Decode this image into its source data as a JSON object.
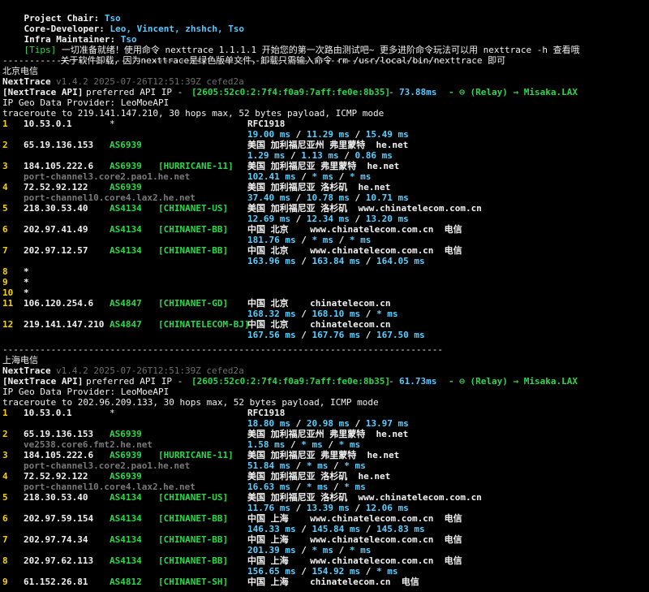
{
  "header": {
    "chair_label": "Project Chair:",
    "chair": "Tso",
    "dev_label": "Core-Developer:",
    "devs": [
      "Leo,",
      "Vincent,",
      "zhshch,",
      "Tso"
    ],
    "maint_label": "Infra Maintainer:",
    "maint": "Tso",
    "tips_tag": "[Tips]",
    "tips_1": "一切准备就绪！使用命令 nexttrace 1.1.1.1 开始您的第一次路由测试吧~ 更多进阶命令玩法可以用 nexttrace -h 查看哦",
    "tips_2": "关于软件卸载，因为nexttrace是绿色版单文件，卸载只需输入命令 rm /usr/local/bin/nexttrace 即可"
  },
  "separator": "----------------------------------------------------------------------------------",
  "sections": [
    {
      "title": "北京电信",
      "app": "NextTrace",
      "version": "v1.4.2 2025-07-26T12:51:39Z cefed2a",
      "api_label": "[NextTrace API]",
      "api_text": "preferred API IP -",
      "api_ip": "[2605:52c0:2:7f4:f0a9:7aff:fe0e:8b35]",
      "api_dash": "-",
      "api_latency": "73.88ms",
      "api_relay": "- ⊖ (Relay) → Misaka.LAX",
      "geo": "IP Geo Data Provider: LeoMoeAPI",
      "trace": "traceroute to 219.141.147.210, 30 hops max, 52 bytes payload, ICMP mode",
      "hops": [
        {
          "n": "1",
          "ip": "10.53.0.1",
          "asn": "*",
          "tag": "",
          "geo": "RFC1918",
          "ptr": "",
          "t1": "19.00 ms",
          "t2": "11.29 ms",
          "t3": "15.49 ms"
        },
        {
          "n": "2",
          "ip": "65.19.136.153",
          "asn": "AS6939",
          "tag": "",
          "geo": "美国 加利福尼亚州 弗里蒙特  he.net",
          "ptr": "",
          "t1": "1.29 ms",
          "t2": "1.13 ms",
          "t3": "0.86 ms"
        },
        {
          "n": "3",
          "ip": "184.105.222.6",
          "asn": "AS6939",
          "tag": "[HURRICANE-11]",
          "geo": "美国 加利福尼亚 弗里蒙特  he.net",
          "ptr": "port-channel3.core2.pao1.he.net",
          "t1": "102.41 ms",
          "t2": "* ms",
          "t3": "* ms"
        },
        {
          "n": "4",
          "ip": "72.52.92.122",
          "asn": "AS6939",
          "tag": "",
          "geo": "美国 加利福尼亚 洛杉矶  he.net",
          "ptr": "port-channel10.core4.lax2.he.net",
          "t1": "37.40 ms",
          "t2": "10.78 ms",
          "t3": "10.71 ms"
        },
        {
          "n": "5",
          "ip": "218.30.53.40",
          "asn": "AS4134",
          "tag": "[CHINANET-US]",
          "geo": "美国 加利福尼亚 洛杉矶  www.chinatelecom.com.cn",
          "ptr": "",
          "t1": "12.69 ms",
          "t2": "12.34 ms",
          "t3": "13.20 ms"
        },
        {
          "n": "6",
          "ip": "202.97.41.49",
          "asn": "AS4134",
          "tag": "[CHINANET-BB]",
          "geo": "中国 北京    www.chinatelecom.com.cn  电信",
          "ptr": "",
          "t1": "181.76 ms",
          "t2": "* ms",
          "t3": "* ms"
        },
        {
          "n": "7",
          "ip": "202.97.12.57",
          "asn": "AS4134",
          "tag": "[CHINANET-BB]",
          "geo": "中国 北京    www.chinatelecom.com.cn  电信",
          "ptr": "",
          "t1": "163.96 ms",
          "t2": "163.84 ms",
          "t3": "164.05 ms"
        },
        {
          "n": "8",
          "ip": "*",
          "asn": "",
          "tag": "",
          "geo": "",
          "ptr": "",
          "t1": "",
          "t2": "",
          "t3": ""
        },
        {
          "n": "9",
          "ip": "*",
          "asn": "",
          "tag": "",
          "geo": "",
          "ptr": "",
          "t1": "",
          "t2": "",
          "t3": ""
        },
        {
          "n": "10",
          "ip": "*",
          "asn": "",
          "tag": "",
          "geo": "",
          "ptr": "",
          "t1": "",
          "t2": "",
          "t3": ""
        },
        {
          "n": "11",
          "ip": "106.120.254.6",
          "asn": "AS4847",
          "tag": "[CHINANET-GD]",
          "geo": "中国 北京    chinatelecom.cn",
          "ptr": "",
          "t1": "168.32 ms",
          "t2": "168.10 ms",
          "t3": "* ms"
        },
        {
          "n": "12",
          "ip": "219.141.147.210",
          "asn": "AS4847",
          "tag": "[CHINATELECOM-BJ]",
          "geo": "中国 北京    chinatelecom.cn",
          "ptr": "",
          "t1": "167.56 ms",
          "t2": "167.76 ms",
          "t3": "167.50 ms"
        }
      ]
    },
    {
      "title": "上海电信",
      "app": "NextTrace",
      "version": "v1.4.2 2025-07-26T12:51:39Z cefed2a",
      "api_label": "[NextTrace API]",
      "api_text": "preferred API IP -",
      "api_ip": "[2605:52c0:2:7f4:f0a9:7aff:fe0e:8b35]",
      "api_dash": "-",
      "api_latency": "61.73ms",
      "api_relay": "- ⊖ (Relay) → Misaka.LAX",
      "geo": "IP Geo Data Provider: LeoMoeAPI",
      "trace": "traceroute to 202.96.209.133, 30 hops max, 52 bytes payload, ICMP mode",
      "hops": [
        {
          "n": "1",
          "ip": "10.53.0.1",
          "asn": "*",
          "tag": "",
          "geo": "RFC1918",
          "ptr": "",
          "t1": "18.80 ms",
          "t2": "20.98 ms",
          "t3": "13.97 ms"
        },
        {
          "n": "2",
          "ip": "65.19.136.153",
          "asn": "AS6939",
          "tag": "",
          "geo": "美国 加利福尼亚州 弗里蒙特  he.net",
          "ptr": "ve2538.core6.fmt2.he.net",
          "t1": "1.58 ms",
          "t2": "* ms",
          "t3": "* ms"
        },
        {
          "n": "3",
          "ip": "184.105.222.6",
          "asn": "AS6939",
          "tag": "[HURRICANE-11]",
          "geo": "美国 加利福尼亚 弗里蒙特  he.net",
          "ptr": "port-channel3.core2.pao1.he.net",
          "t1": "51.84 ms",
          "t2": "* ms",
          "t3": "* ms"
        },
        {
          "n": "4",
          "ip": "72.52.92.122",
          "asn": "AS6939",
          "tag": "",
          "geo": "美国 加利福尼亚 洛杉矶  he.net",
          "ptr": "port-channel10.core4.lax2.he.net",
          "t1": "16.63 ms",
          "t2": "* ms",
          "t3": "* ms"
        },
        {
          "n": "5",
          "ip": "218.30.53.40",
          "asn": "AS4134",
          "tag": "[CHINANET-US]",
          "geo": "美国 加利福尼亚 洛杉矶  www.chinatelecom.com.cn",
          "ptr": "",
          "t1": "11.76 ms",
          "t2": "13.39 ms",
          "t3": "12.06 ms"
        },
        {
          "n": "6",
          "ip": "202.97.59.154",
          "asn": "AS4134",
          "tag": "[CHINANET-BB]",
          "geo": "中国 上海    www.chinatelecom.com.cn  电信",
          "ptr": "",
          "t1": "146.33 ms",
          "t2": "145.84 ms",
          "t3": "145.83 ms"
        },
        {
          "n": "7",
          "ip": "202.97.74.34",
          "asn": "AS4134",
          "tag": "[CHINANET-BB]",
          "geo": "中国 上海    www.chinatelecom.com.cn  电信",
          "ptr": "",
          "t1": "201.39 ms",
          "t2": "* ms",
          "t3": "* ms"
        },
        {
          "n": "8",
          "ip": "202.97.62.113",
          "asn": "AS4134",
          "tag": "[CHINANET-BB]",
          "geo": "中国 上海    www.chinatelecom.com.cn  电信",
          "ptr": "",
          "t1": "156.65 ms",
          "t2": "154.92 ms",
          "t3": "* ms"
        },
        {
          "n": "9",
          "ip": "61.152.26.81",
          "asn": "AS4812",
          "tag": "[CHINANET-SH]",
          "geo": "中国 上海    chinatelecom.cn  电信",
          "ptr": "",
          "t1": "",
          "t2": "",
          "t3": ""
        }
      ]
    }
  ]
}
